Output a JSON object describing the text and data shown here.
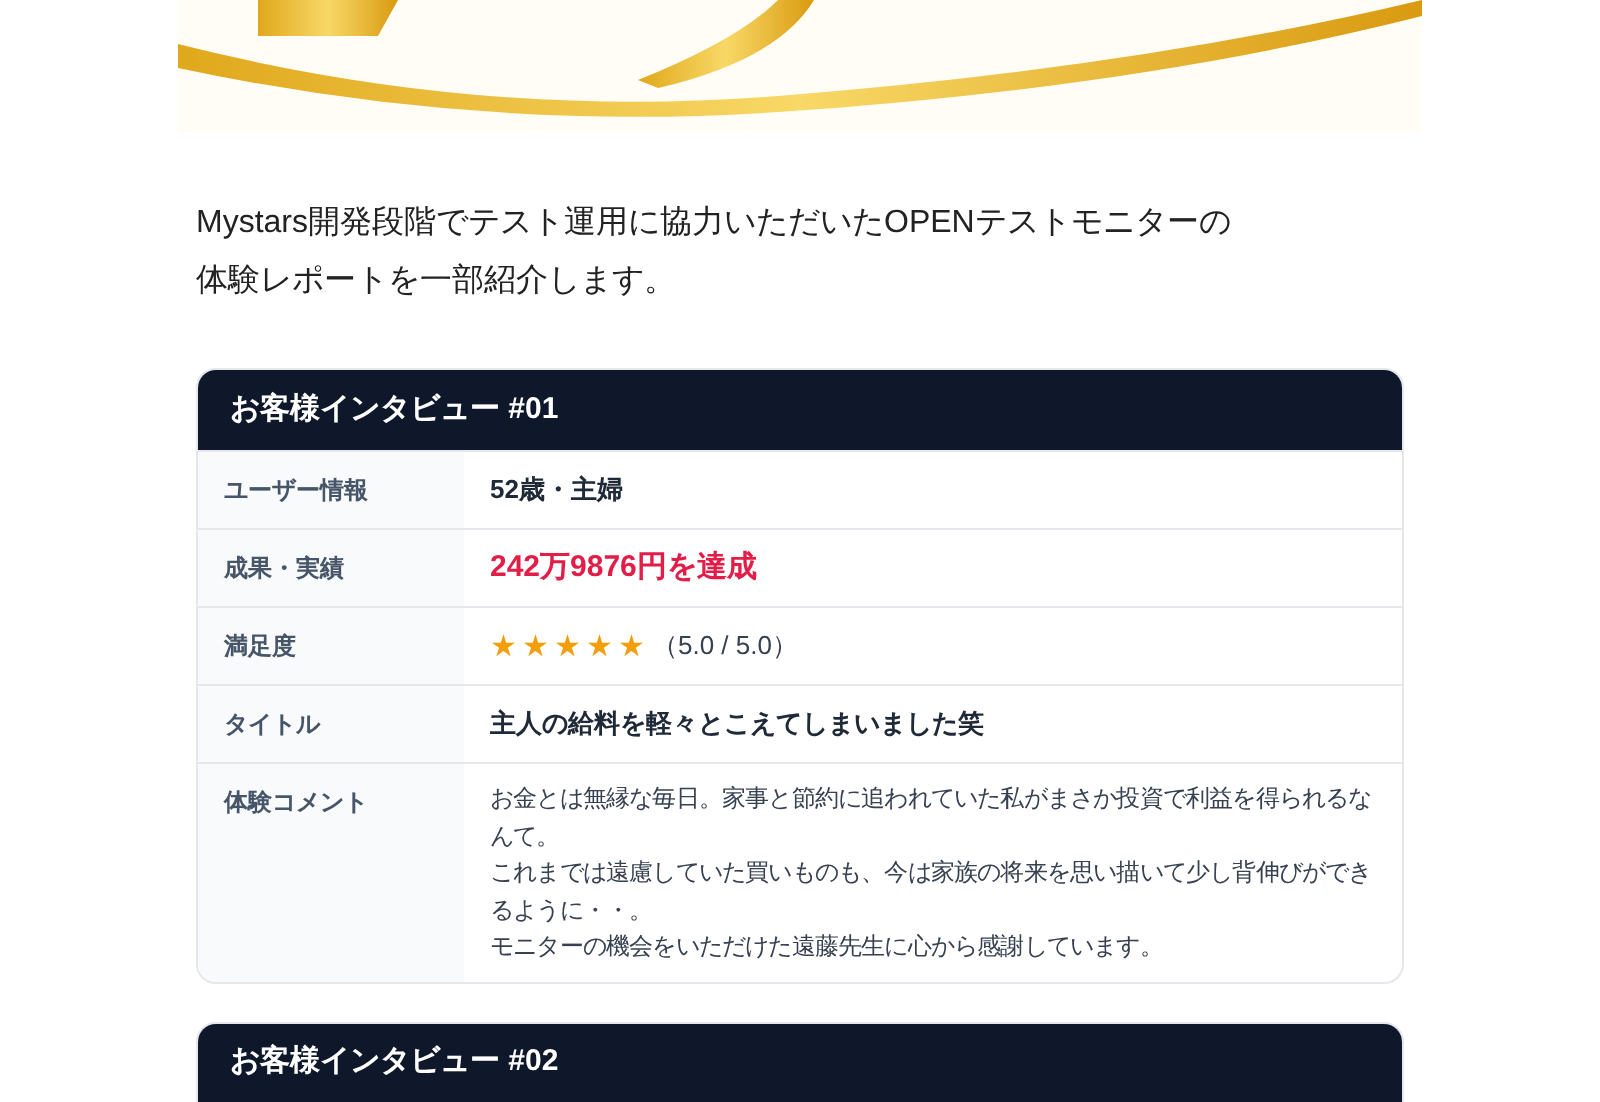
{
  "intro": {
    "lines": [
      "Mystars開発段階でテスト運用に協力いただいたOPENテストモニターの",
      "体験レポートを一部紹介します。"
    ]
  },
  "interviews": [
    {
      "title": "お客様インタビュー #01",
      "rows": [
        {
          "kind": "text",
          "label": "ユーザー情報",
          "value": "52歳・主婦"
        },
        {
          "kind": "highlight",
          "label": "成果・実績",
          "value": "242万9876円を達成"
        },
        {
          "kind": "rating",
          "label": "満足度",
          "stars": 5,
          "value": "（5.0 / 5.0）"
        },
        {
          "kind": "title",
          "label": "タイトル",
          "value": "主人の給料を軽々とこえてしまいました笑"
        },
        {
          "kind": "comment",
          "label": "体験コメント",
          "lines": [
            "お金とは無縁な毎日。家事と節約に追われていた私がまさか投資で利益を得られるなんて。",
            "これまでは遠慮していた買いものも、今は家族の将来を思い描いて少し背伸びができるように・・。",
            "モニターの機会をいただけた遠藤先生に心から感謝しています。"
          ]
        }
      ]
    },
    {
      "title": "お客様インタビュー #02"
    }
  ]
}
